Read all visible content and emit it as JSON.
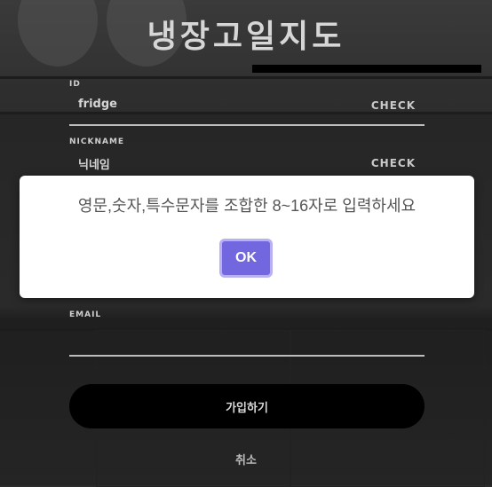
{
  "header": {
    "title": "냉장고일지도"
  },
  "form": {
    "id": {
      "label": "ID",
      "value": "fridge",
      "check_label": "CHECK"
    },
    "nickname": {
      "label": "NICKNAME",
      "value": "닉네임",
      "check_label": "CHECK"
    },
    "email": {
      "label": "EMAIL",
      "value": ""
    },
    "submit_label": "가입하기",
    "cancel_label": "취소"
  },
  "dialog": {
    "message": "영문,숫자,특수문자를 조합한 8~16자로 입력하세요",
    "ok_label": "OK"
  },
  "colors": {
    "accent": "#7367e0",
    "button_bg": "#000000"
  }
}
